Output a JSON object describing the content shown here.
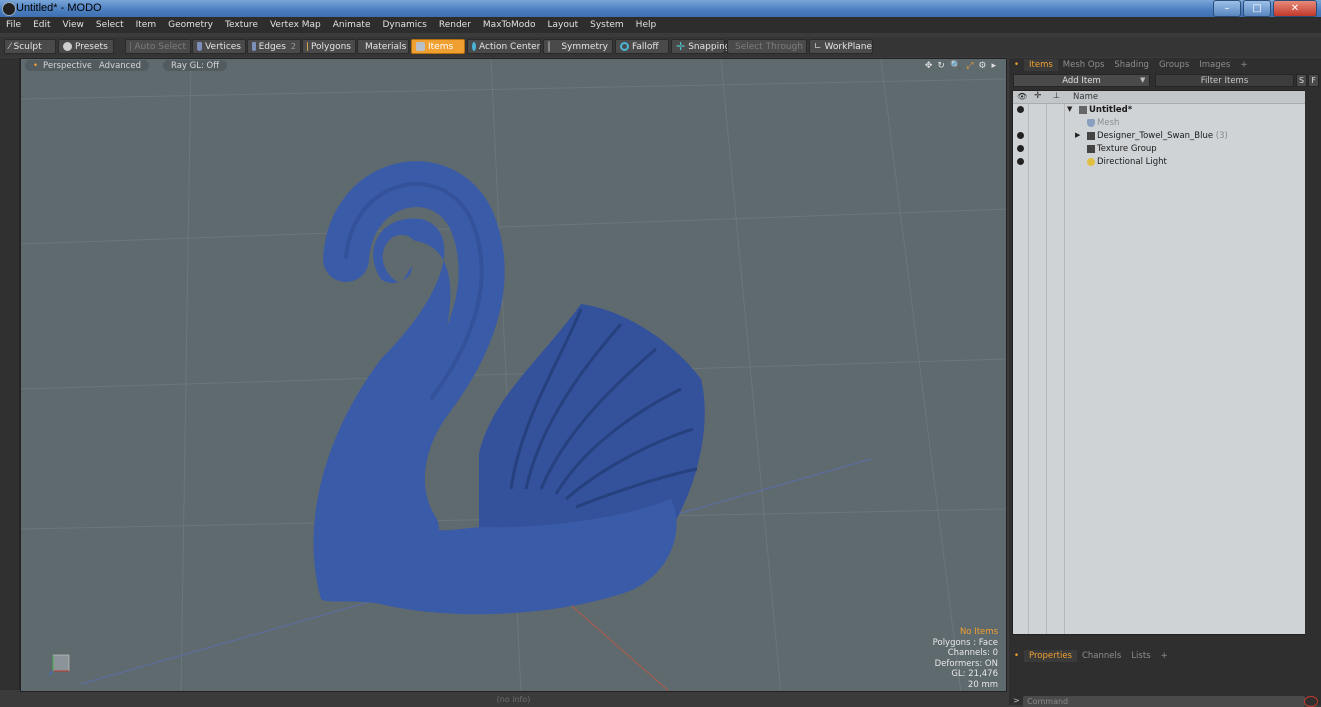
{
  "window": {
    "title": "Untitled* - MODO",
    "minimize": "–",
    "maximize": "□",
    "close": "✕"
  },
  "menu": [
    "File",
    "Edit",
    "View",
    "Select",
    "Item",
    "Geometry",
    "Texture",
    "Vertex Map",
    "Animate",
    "Dynamics",
    "Render",
    "MaxToModo",
    "Layout",
    "System",
    "Help"
  ],
  "toolbar": {
    "sculpt": "Sculpt",
    "presets": "Presets",
    "auto_select": "Auto Select",
    "vertices": "Vertices",
    "edges": "Edges",
    "edges_badge": "2",
    "polygons": "Polygons",
    "materials": "Materials",
    "items": "Items",
    "action_center": "Action Center",
    "symmetry": "Symmetry",
    "falloff": "Falloff",
    "snapping": "Snapping",
    "select_through": "Select Through",
    "workplane": "WorkPlane"
  },
  "viewport": {
    "tabs": [
      "Perspective",
      "Advanced",
      "Ray GL: Off"
    ],
    "icons": [
      "✥",
      "↻",
      "🔍",
      "⤢",
      "⚙",
      "▸"
    ],
    "stats": {
      "items": "No Items",
      "polygons": "Polygons : Face",
      "channels": "Channels: 0",
      "deformers": "Deformers: ON",
      "gl": "GL: 21,476",
      "scale": "20 mm"
    }
  },
  "status_text": "(no info)",
  "right_panel": {
    "tabs": [
      "Items",
      "Mesh Ops",
      "Shading",
      "Groups",
      "Images",
      "+"
    ],
    "add_item": "Add Item",
    "filter": "Filter Items",
    "btn_s": "S",
    "btn_f": "F",
    "column_name": "Name",
    "tree": [
      {
        "label": "Untitled*",
        "indent": 0,
        "bold": true
      },
      {
        "label": "Mesh",
        "indent": 1,
        "dim": true
      },
      {
        "label": "Designer_Towel_Swan_Blue",
        "suffix": "(3)",
        "indent": 1
      },
      {
        "label": "Texture Group",
        "indent": 1
      },
      {
        "label": "Directional Light",
        "indent": 1
      }
    ],
    "bottom_tabs": [
      "Properties",
      "Channels",
      "Lists",
      "+"
    ],
    "command_placeholder": "Command"
  },
  "colors": {
    "accent": "#f0a030",
    "swan": "#3a5ba8",
    "viewport_bg": "#5f6a6f"
  }
}
